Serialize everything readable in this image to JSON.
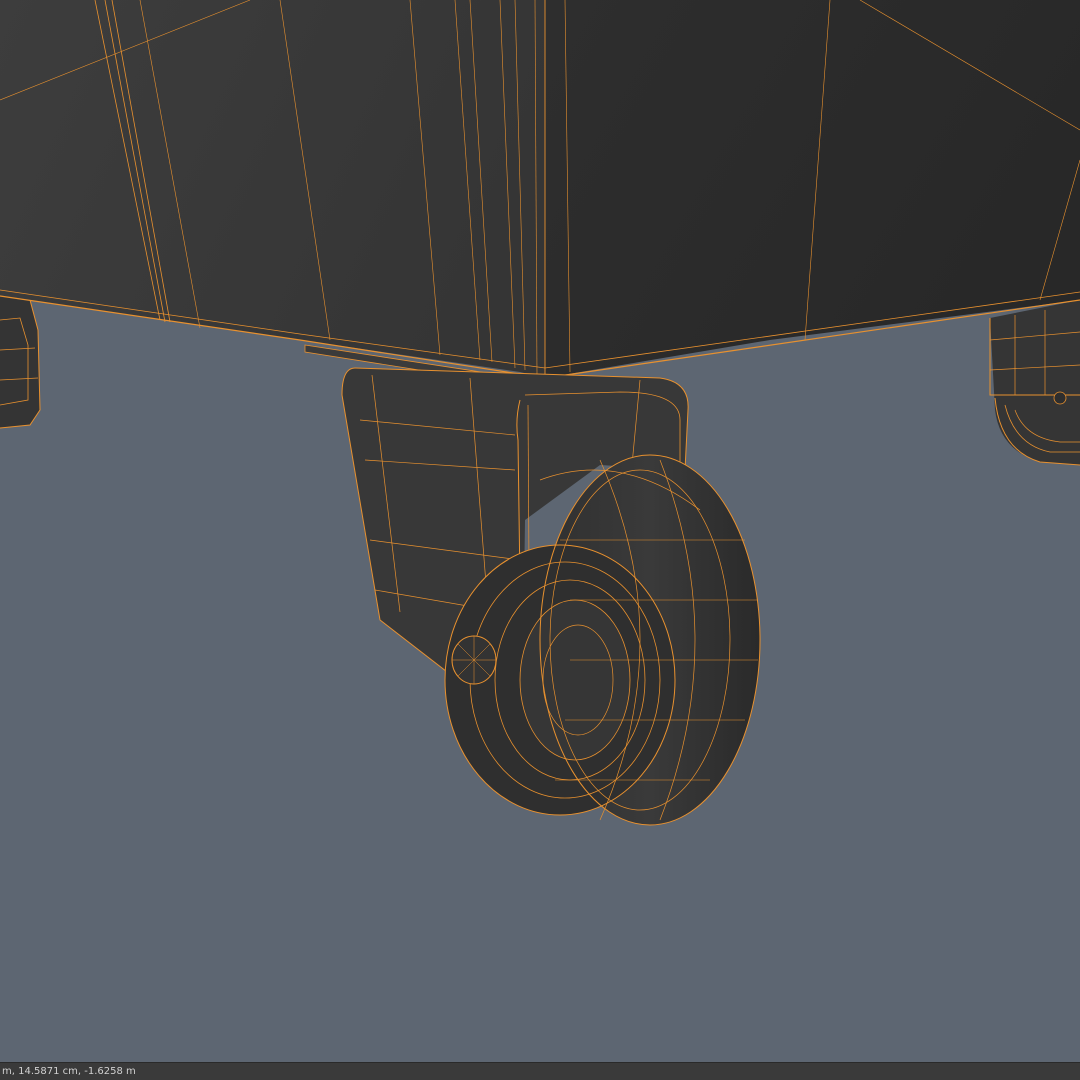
{
  "viewport": {
    "background_color": "#5d6672",
    "shaded_surface_color": "#3a3a3a",
    "wireframe_color": "#e8912f"
  },
  "status_bar": {
    "coordinates": "m, 14.5871 cm, -1.6258 m"
  }
}
